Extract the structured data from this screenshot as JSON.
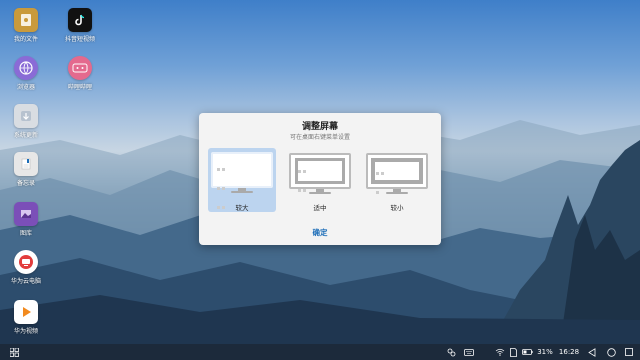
{
  "desktop": {
    "icons": [
      {
        "label": "我的文件",
        "icon": "folder-icon",
        "color": "#c99a3c"
      },
      {
        "label": "抖音短视频",
        "icon": "tiktok-icon",
        "color": "#111111"
      },
      {
        "label": "浏览器",
        "icon": "browser-icon",
        "color": "#8a6bd6"
      },
      {
        "label": "哔哩哔哩",
        "icon": "bilibili-icon",
        "color": "#e46a8e"
      },
      {
        "label": "系统更新",
        "icon": "update-icon",
        "color": "#d9dde2"
      },
      {
        "label": "备忘录",
        "icon": "notes-icon",
        "color": "#e7e7e7"
      },
      {
        "label": "图库",
        "icon": "gallery-icon",
        "color": "#7b4fb8"
      },
      {
        "label": "华为云电脑",
        "icon": "cloud-pc-icon",
        "color": "#e23c3c"
      },
      {
        "label": "华为视频",
        "icon": "video-icon",
        "color": "#f28a1e"
      }
    ]
  },
  "dialog": {
    "title": "调整屏幕",
    "subtitle": "可在桌面右键菜单设置",
    "options": [
      {
        "label": "较大",
        "selected": true
      },
      {
        "label": "适中",
        "selected": false
      },
      {
        "label": "较小",
        "selected": false
      }
    ],
    "confirm_label": "确定",
    "accent_color": "#1b6db8",
    "selected_color": "#bcd4ef"
  },
  "taskbar": {
    "start_icon": "grid-icon",
    "battery_text": "31%",
    "clock": "16:28",
    "tray_icons": [
      "app-switch-icon",
      "keyboard-icon",
      "wifi-icon",
      "sim-icon",
      "battery-icon"
    ],
    "nav_icons": [
      "back-icon",
      "home-icon",
      "recents-icon"
    ]
  }
}
